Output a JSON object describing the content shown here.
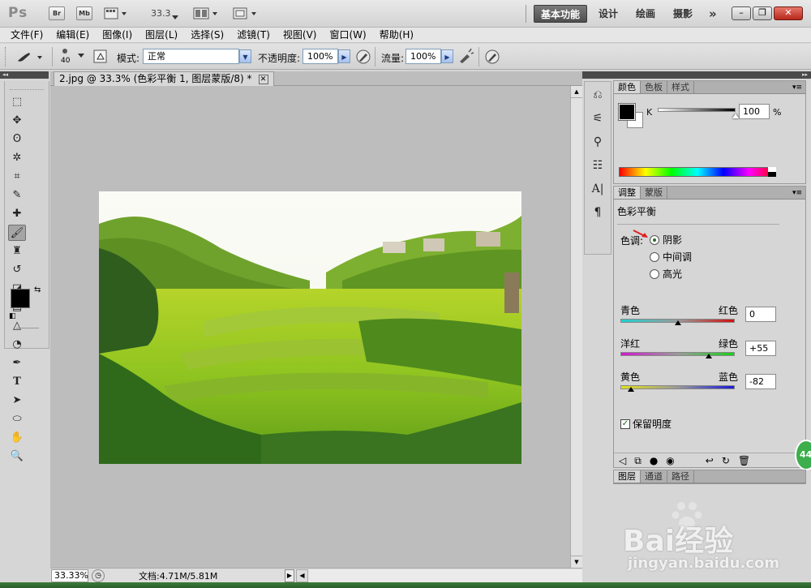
{
  "app": {
    "logo": "Ps",
    "bridge": "Br",
    "minibridge": "Mb",
    "zoom_display": "33.3"
  },
  "workspaces": [
    "基本功能",
    "设计",
    "绘画",
    "摄影"
  ],
  "window_controls": {
    "more": "»",
    "minimize": "–",
    "restore": "❐",
    "close": "✕"
  },
  "menu": [
    "文件(F)",
    "编辑(E)",
    "图像(I)",
    "图层(L)",
    "选择(S)",
    "滤镜(T)",
    "视图(V)",
    "窗口(W)",
    "帮助(H)"
  ],
  "options": {
    "brush_size": "40",
    "mode_label": "模式:",
    "mode_value": "正常",
    "opacity_label": "不透明度:",
    "opacity_value": "100%",
    "flow_label": "流量:",
    "flow_value": "100%"
  },
  "document": {
    "tab_title": "2.jpg @ 33.3% (色彩平衡 1, 图层蒙版/8) *",
    "status_zoom": "33.33%",
    "status_doc": "文档:4.71M/5.81M"
  },
  "color_panel": {
    "tabs": [
      "颜色",
      "色板",
      "样式"
    ],
    "channel_label": "K",
    "channel_value": "100",
    "percent": "%",
    "k_level_percent": 100
  },
  "adjust_panel": {
    "tabs": [
      "调整",
      "蒙版"
    ],
    "title": "色彩平衡",
    "tone_label": "色调:",
    "tones": [
      {
        "label": "阴影",
        "selected": true
      },
      {
        "label": "中间调",
        "selected": false
      },
      {
        "label": "高光",
        "selected": false
      }
    ],
    "sliders": [
      {
        "left": "青色",
        "right": "红色",
        "value": "0",
        "level": 0,
        "colors": [
          "#1fd0d0",
          "#d21010"
        ]
      },
      {
        "left": "洋红",
        "right": "绿色",
        "value": "+55",
        "level": 55,
        "colors": [
          "#d118d1",
          "#18d118"
        ]
      },
      {
        "left": "黄色",
        "right": "蓝色",
        "value": "-82",
        "level": -82,
        "colors": [
          "#e2e21a",
          "#1a1ad8"
        ]
      }
    ],
    "preserve_label": "保留明度",
    "preserve_checked": true
  },
  "layers_panel": {
    "tabs": [
      "图层",
      "通道",
      "路径"
    ]
  },
  "watermark": {
    "brand": "Bai经验",
    "url": "jingyan.baidu.com"
  },
  "badge": "44"
}
